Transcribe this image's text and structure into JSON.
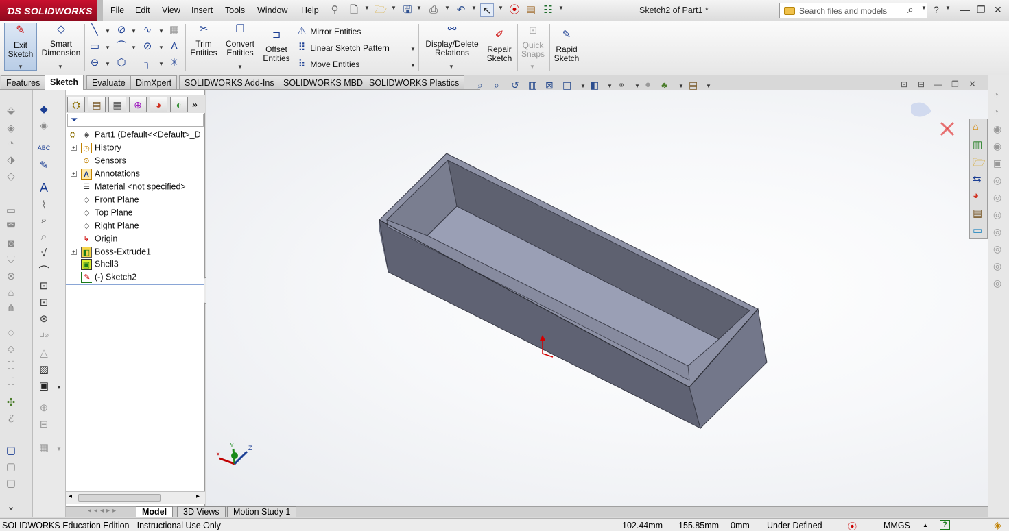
{
  "app": {
    "logo_text": "SOLIDWORKS",
    "document_title": "Sketch2 of Part1 *"
  },
  "menu": [
    "File",
    "Edit",
    "View",
    "Insert",
    "Tools",
    "Window",
    "Help"
  ],
  "search": {
    "placeholder": "Search files and models"
  },
  "command_manager": {
    "exit_sketch": "Exit\nSketch",
    "smart_dimension": "Smart\nDimension",
    "trim_entities": "Trim\nEntities",
    "convert_entities": "Convert\nEntities",
    "offset_entities": "Offset\nEntities",
    "mirror_entities": "Mirror Entities",
    "linear_sketch_pattern": "Linear Sketch Pattern",
    "move_entities": "Move Entities",
    "display_delete_relations": "Display/Delete\nRelations",
    "repair_sketch": "Repair\nSketch",
    "quick_snaps": "Quick\nSnaps",
    "rapid_sketch": "Rapid\nSketch"
  },
  "tabs": [
    "Features",
    "Sketch",
    "Evaluate",
    "DimXpert",
    "SOLIDWORKS Add-Ins",
    "SOLIDWORKS MBD",
    "SOLIDWORKS Plastics"
  ],
  "active_tab": "Sketch",
  "feature_tree": {
    "root": "Part1  (Default<<Default>_D",
    "items": [
      {
        "label": "History",
        "expandable": true
      },
      {
        "label": "Sensors",
        "expandable": false
      },
      {
        "label": "Annotations",
        "expandable": true
      },
      {
        "label": "Material <not specified>",
        "expandable": false
      },
      {
        "label": "Front Plane",
        "expandable": false
      },
      {
        "label": "Top Plane",
        "expandable": false
      },
      {
        "label": "Right Plane",
        "expandable": false
      },
      {
        "label": "Origin",
        "expandable": false
      },
      {
        "label": "Boss-Extrude1",
        "expandable": true
      },
      {
        "label": "Shell3",
        "expandable": false
      },
      {
        "label": "(-) Sketch2",
        "expandable": false
      }
    ]
  },
  "triad": {
    "x": "X",
    "y": "Y",
    "z": "Z"
  },
  "bottom_tabs": [
    "Model",
    "3D Views",
    "Motion Study 1"
  ],
  "status": {
    "edition": "SOLIDWORKS Education Edition - Instructional Use Only",
    "x": "102.44mm",
    "y": "155.85mm",
    "z": "0mm",
    "sketch_state": "Under Defined",
    "units": "MMGS"
  },
  "colors": {
    "brand": "#c8102e",
    "model_face_dark": "#5f6273",
    "model_face_mid": "#72778a",
    "model_face_light": "#9a9fb5",
    "accent_blue": "#1c3f94"
  }
}
